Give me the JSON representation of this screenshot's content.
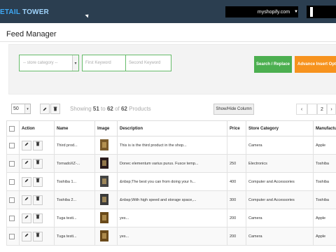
{
  "header": {
    "logo_left": "ETAIL",
    "logo_right": " TOWER",
    "store_suffix": "myshopify.com",
    "store_caret": "▼"
  },
  "page_title": "Feed Manager",
  "filters": {
    "category_placeholder": "-- store category --",
    "keyword1_placeholder": "First Keyword",
    "keyword2_placeholder": "Second Keyword",
    "search_replace_label": "Search / Replace",
    "advance_insert_label": "Advance Insert Option"
  },
  "toolbar": {
    "per_page": "50",
    "showing_prefix": "Showing ",
    "showing_from": "51",
    "showing_to_word": " to ",
    "showing_to": "62",
    "showing_of_word": " of ",
    "showing_total": "62",
    "showing_suffix": " Products",
    "show_hide_label": "Show/Hide Column",
    "pager_prev": "‹",
    "pager_page": "2",
    "pager_next": "›"
  },
  "table": {
    "columns": [
      "",
      "Action",
      "Name",
      "Image",
      "Description",
      "Price",
      "Store Category",
      "Manufacturer"
    ],
    "rows": [
      {
        "name": "Third prod...",
        "description": "This is is the third product in the shop...",
        "price": "",
        "category": "Camera",
        "manufacturer": "Apple",
        "thumb_color": "#7a5a2a"
      },
      {
        "name": "TornadoXZ-...",
        "description": "Donec elementum varius purus. Fusce temp...",
        "price": "250",
        "category": "Electronics",
        "manufacturer": "Toshiba",
        "thumb_color": "#2a1a1a"
      },
      {
        "name": "Toshiba 1...",
        "description": "&nbsp;The best you can from doing your h...",
        "price": "400",
        "category": "Computer and Accessories",
        "manufacturer": "Toshiba",
        "thumb_color": "#444444"
      },
      {
        "name": "Toshiba 2...",
        "description": "&nbsp;With high speed and storage space,...",
        "price": "300",
        "category": "Computer and Accessories",
        "manufacturer": "Toshiba",
        "thumb_color": "#3a3a3a"
      },
      {
        "name": "Tuga testi...",
        "description": "yes...",
        "price": "200",
        "category": "Camera",
        "manufacturer": "Apple",
        "thumb_color": "#6a4a1a"
      },
      {
        "name": "Tuga testi...",
        "description": "yes...",
        "price": "200",
        "category": "Camera",
        "manufacturer": "Apple",
        "thumb_color": "#6a4a1a"
      }
    ]
  },
  "icons": {
    "edit": "pencil-icon",
    "delete": "trash-icon"
  }
}
